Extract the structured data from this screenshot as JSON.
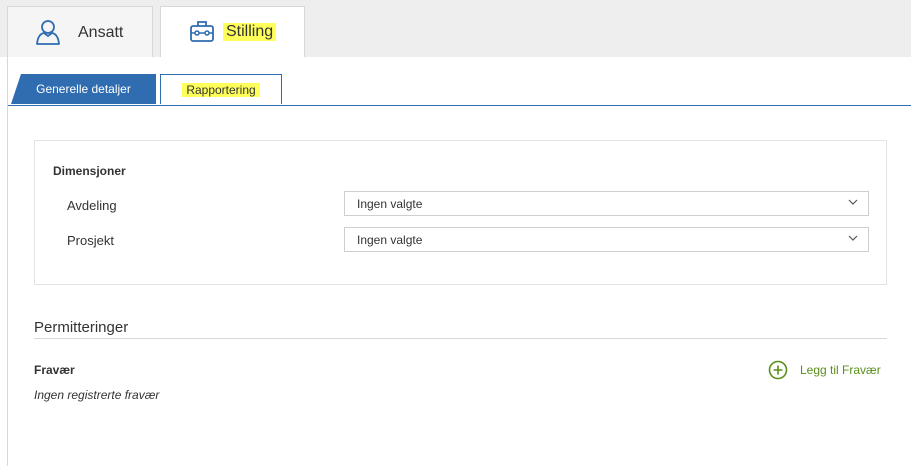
{
  "top_tabs": {
    "employee_label": "Ansatt",
    "position_label": "Stilling"
  },
  "sub_tabs": {
    "general_label": "Generelle detaljer",
    "reporting_label": "Rapportering"
  },
  "dimensions": {
    "title": "Dimensjoner",
    "rows": [
      {
        "label": "Avdeling",
        "value": "Ingen valgte"
      },
      {
        "label": "Prosjekt",
        "value": "Ingen valgte"
      }
    ]
  },
  "layoffs": {
    "title": "Permitteringer"
  },
  "absence": {
    "title": "Fravær",
    "empty_text": "Ingen registrerte fravær",
    "add_label": "Legg til Fravær"
  },
  "colors": {
    "accent_blue": "#2f6db0",
    "add_green": "#5a8f1b",
    "highlight": "#ffff5a"
  },
  "icons": [
    "user-icon",
    "briefcase-icon",
    "chevron-down-icon",
    "plus-circle-icon"
  ]
}
